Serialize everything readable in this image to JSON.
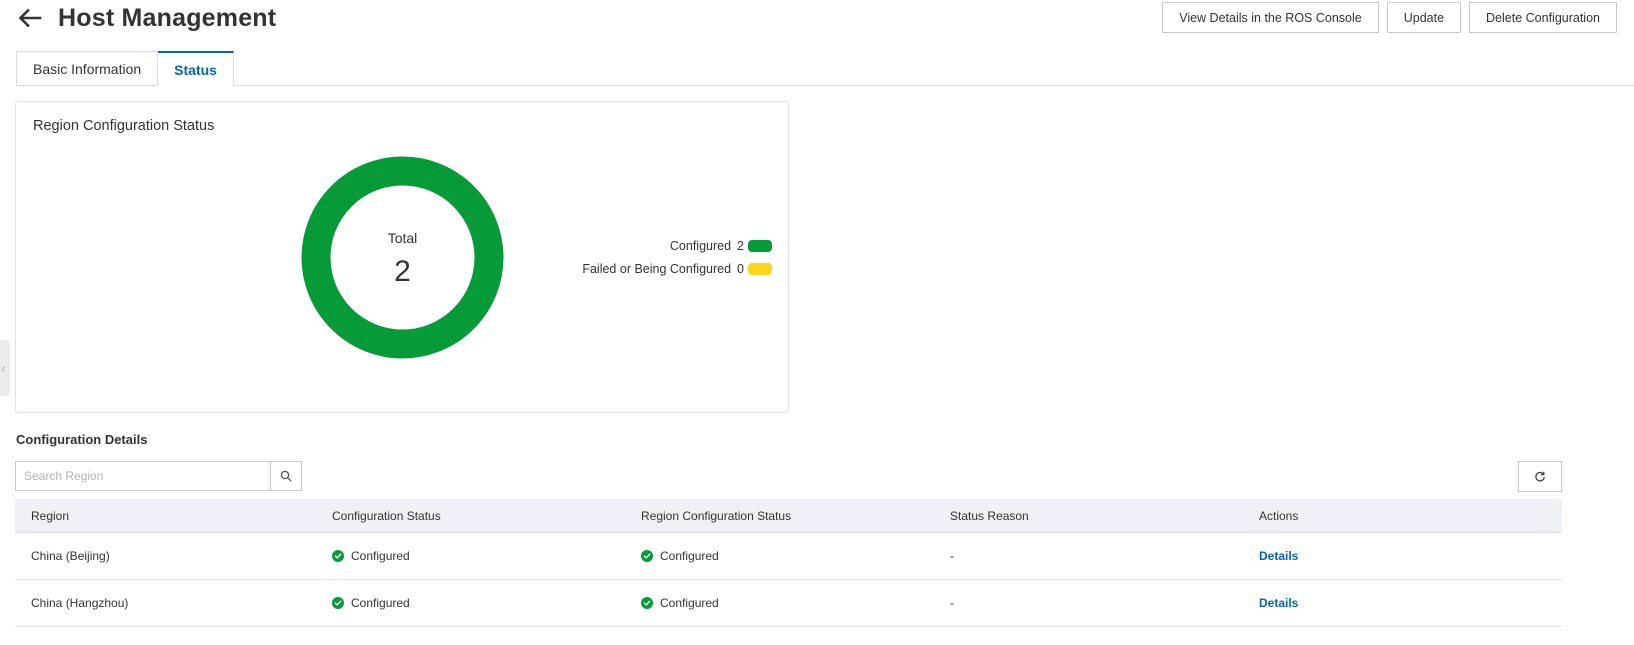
{
  "header": {
    "title": "Host Management",
    "actions": {
      "view_ros": "View Details in the ROS Console",
      "update": "Update",
      "delete": "Delete Configuration"
    }
  },
  "tabs": [
    {
      "label": "Basic Information",
      "active": false
    },
    {
      "label": "Status",
      "active": true
    }
  ],
  "status_card": {
    "title": "Region Configuration Status",
    "total_label": "Total",
    "total_value": "2"
  },
  "chart_data": {
    "type": "pie",
    "categories": [
      "Configured",
      "Failed or Being Configured"
    ],
    "values": [
      2,
      0
    ],
    "colors": [
      "#069a38",
      "#ffd41f"
    ],
    "legend_placement": "right"
  },
  "details": {
    "title": "Configuration Details",
    "search_placeholder": "Search Region",
    "columns": [
      "Region",
      "Configuration Status",
      "Region Configuration Status",
      "Status Reason",
      "Actions"
    ],
    "rows": [
      {
        "region": "China (Beijing)",
        "config_status": "Configured",
        "region_status": "Configured",
        "reason": "-",
        "action": "Details"
      },
      {
        "region": "China (Hangzhou)",
        "config_status": "Configured",
        "region_status": "Configured",
        "reason": "-",
        "action": "Details"
      }
    ]
  },
  "colors": {
    "accent": "#0064c8",
    "success": "#069a38",
    "warning": "#ffd41f"
  },
  "icons": {
    "back": "arrow-left-icon",
    "search": "search-icon",
    "refresh": "refresh-icon",
    "status": "check-circle-icon",
    "collapse": "chevron-left-icon"
  }
}
